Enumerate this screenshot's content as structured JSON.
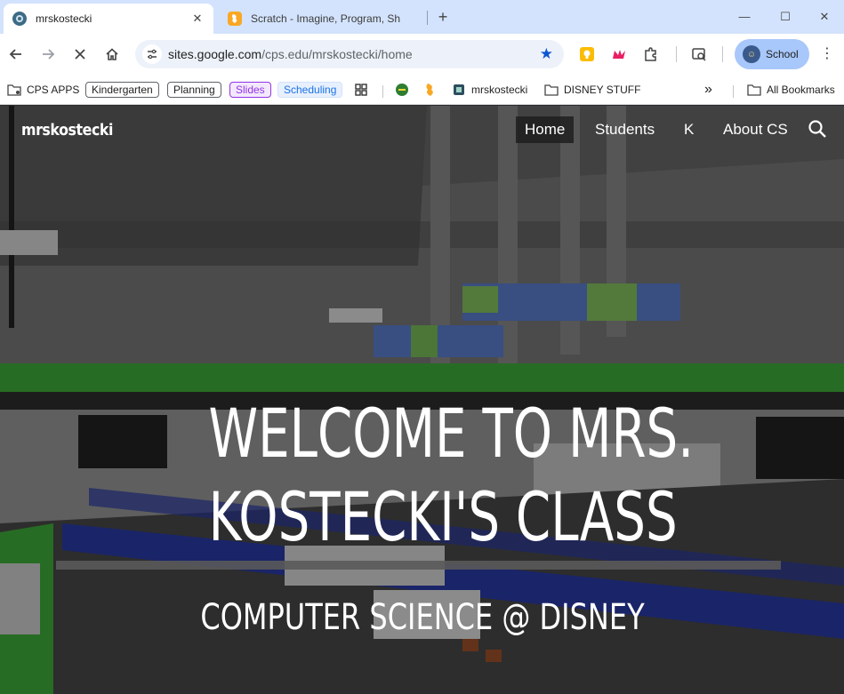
{
  "browser": {
    "tabs": [
      {
        "title": "mrskostecki",
        "active": true
      },
      {
        "title": "Scratch - Imagine, Program, Sh",
        "active": false
      }
    ],
    "new_tab_symbol": "+",
    "window_controls": {
      "minimize": "—",
      "maximize": "☐",
      "close": "✕"
    },
    "toolbar": {
      "back_icon": "arrow-left-icon",
      "forward_icon": "arrow-right-icon",
      "reload_state": "stop-loading",
      "home_icon": "home-icon",
      "url_host": "sites.google.com",
      "url_path": "/cps.edu/mrskostecki/home",
      "bookmarked": true
    },
    "extensions": [
      "lightbulb-extension-icon",
      "pink-crown-extension-icon",
      "puzzle-extensions-icon",
      "tab-search-icon"
    ],
    "profile": {
      "label": "School"
    },
    "bookmarks": [
      {
        "label": "CPS APPS",
        "type": "folder-app"
      },
      {
        "label": "Kindergarten",
        "type": "chip",
        "border": "#5f6368",
        "color": "#1f1f1f",
        "bg": "#ffffff"
      },
      {
        "label": "Planning",
        "type": "chip",
        "border": "#5f6368",
        "color": "#1f1f1f",
        "bg": "#ffffff"
      },
      {
        "label": "Slides",
        "type": "chip",
        "border": "#9334e6",
        "color": "#9334e6",
        "bg": "#f3e8fd"
      },
      {
        "label": "Scheduling",
        "type": "chip",
        "border": "#d2e3fc",
        "color": "#1a73e8",
        "bg": "#e8f0fe"
      },
      {
        "label": "mrskostecki",
        "type": "site"
      },
      {
        "label": "DISNEY STUFF",
        "type": "folder"
      },
      {
        "label": "All Bookmarks",
        "type": "folder"
      }
    ],
    "overflow_symbol": "»"
  },
  "site": {
    "name": "mrskostecki",
    "nav": [
      {
        "label": "Home",
        "active": true
      },
      {
        "label": "Students",
        "active": false
      },
      {
        "label": "K",
        "active": false
      },
      {
        "label": "About CS",
        "active": false
      }
    ],
    "hero": {
      "title_line1": "WELCOME TO MRS.",
      "title_line2": "KOSTECKI'S CLASS",
      "subtitle": "COMPUTER SCIENCE @ DISNEY"
    }
  },
  "colors": {
    "tabstrip": "#d3e3fd",
    "accent": "#0b57d0",
    "profile_chip": "#a8c7fa",
    "scene_green": "#3fae3a",
    "scene_blue": "#2b3aa8"
  }
}
